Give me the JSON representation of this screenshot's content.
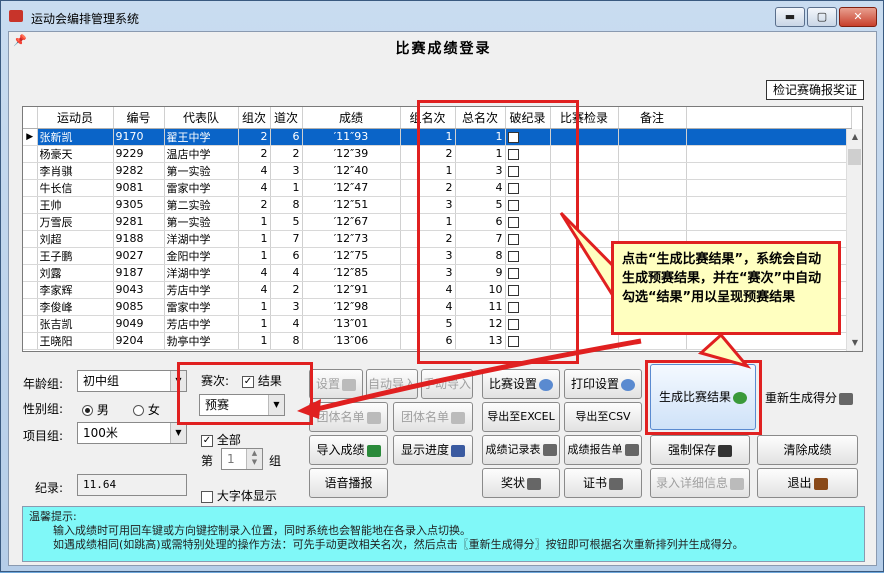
{
  "window": {
    "title": "运动会编排管理系统",
    "minimize": "▬",
    "maximize": "▢",
    "close": "✕"
  },
  "heading": "比赛成绩登录",
  "award_button": "检记赛确报奖证",
  "table": {
    "columns": [
      "运动员",
      "编号",
      "代表队",
      "组次",
      "道次",
      "成绩",
      "组名次",
      "总名次",
      "破纪录",
      "比赛检录",
      "备注"
    ],
    "rows": [
      [
        "张新凯",
        "9170",
        "翟王中学",
        "2",
        "6",
        "′11″93",
        "1",
        "1"
      ],
      [
        "杨豪天",
        "9229",
        "温店中学",
        "2",
        "2",
        "′12″39",
        "2",
        "1"
      ],
      [
        "李肖骐",
        "9282",
        "第一实验",
        "4",
        "3",
        "′12″40",
        "1",
        "3"
      ],
      [
        "牛长信",
        "9081",
        "雷家中学",
        "4",
        "1",
        "′12″47",
        "2",
        "4"
      ],
      [
        "王帅",
        "9305",
        "第二实验",
        "2",
        "8",
        "′12″51",
        "3",
        "5"
      ],
      [
        "万雪辰",
        "9281",
        "第一实验",
        "1",
        "5",
        "′12″67",
        "1",
        "6"
      ],
      [
        "刘超",
        "9188",
        "洋湖中学",
        "1",
        "7",
        "′12″73",
        "2",
        "7"
      ],
      [
        "王子鹏",
        "9027",
        "金阳中学",
        "1",
        "6",
        "′12″75",
        "3",
        "8"
      ],
      [
        "刘露",
        "9187",
        "洋湖中学",
        "4",
        "4",
        "′12″85",
        "3",
        "9"
      ],
      [
        "李家辉",
        "9043",
        "芳店中学",
        "4",
        "2",
        "′12″91",
        "4",
        "10"
      ],
      [
        "李俊峰",
        "9085",
        "雷家中学",
        "1",
        "3",
        "′12″98",
        "4",
        "11"
      ],
      [
        "张吉凯",
        "9049",
        "芳店中学",
        "1",
        "4",
        "′13″01",
        "5",
        "12"
      ],
      [
        "王晓阳",
        "9204",
        "勃亭中学",
        "1",
        "8",
        "′13″06",
        "6",
        "13"
      ]
    ]
  },
  "form": {
    "age_group_label": "年龄组:",
    "age_group_value": "初中组",
    "gender_label": "性别组:",
    "gender_male": "男",
    "gender_female": "女",
    "event_label": "项目组:",
    "event_value": "100米",
    "record_label": "纪录:",
    "record_value": "11.64",
    "round_label": "赛次:",
    "result_label": "结果",
    "round_value": "预赛",
    "all_label": "全部",
    "group_prefix": "第",
    "group_value": "1",
    "group_suffix": "组",
    "big_font_label": "大字体显示"
  },
  "buttons": {
    "setup": "设置",
    "auto_import": "自动导入",
    "manual_import": "手动导入",
    "list_personal": "团体名单",
    "team_list": "团体名单",
    "import_results": "导入成绩",
    "show_progress": "显示进度",
    "voice": "语音播报",
    "match_settings": "比赛设置",
    "print_settings": "打印设置",
    "export_excel": "导出至EXCEL",
    "export_csv": "导出至CSV",
    "record_table": "成绩记录表",
    "report": "成绩报告单",
    "award": "奖状",
    "certificate": "证书",
    "generate_results": "生成比赛结果",
    "regen_score": "重新生成得分",
    "force_save": "强制保存",
    "clear_results": "清除成绩",
    "detail_entry": "录入详细信息",
    "exit": "退出"
  },
  "callout": "点击“生成比赛结果”，系统会自动生成预赛结果，并在“赛次”中自动勾选“结果”用以呈现预赛结果",
  "tips": {
    "title": "温馨提示:",
    "line1": "输入成绩时可用回车键或方向键控制录入位置，同时系统也会智能地在各录入点切换。",
    "line2": "如遇成绩相同(如跳高)或需特别处理的操作方法：可先手动更改相关名次，然后点击〖重新生成得分〗按钮即可根据名次重新排列并生成得分。"
  },
  "colors": {
    "selected_row": "#0a64c8",
    "highlight": "#e02020",
    "tips_bg": "#80f8f8",
    "callout_bg": "#ffffc0"
  }
}
